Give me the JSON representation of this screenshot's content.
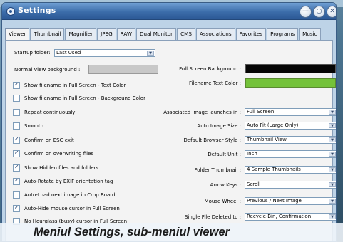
{
  "window": {
    "title": "Settings"
  },
  "tabs": [
    "Viewer",
    "Thumbnail",
    "Magnifier",
    "JPEG",
    "RAW",
    "Dual Monitor",
    "CMS",
    "Associations",
    "Favorites",
    "Programs",
    "Music"
  ],
  "left": {
    "startup_label": "Startup folder:",
    "startup_value": "Last Used",
    "normal_bg_label": "Normal View background :",
    "checkboxes": [
      {
        "label": "Show filename in Full Screen - Text Color",
        "checked": true
      },
      {
        "label": "Show filename in Full Screen - Background Color",
        "checked": false
      },
      {
        "label": "Repeat continuously",
        "checked": false
      },
      {
        "label": "Smooth",
        "checked": false
      },
      {
        "label": "Confirm on ESC exit",
        "checked": true
      },
      {
        "label": "Confirm on overwriting files",
        "checked": true
      },
      {
        "label": "Show Hidden files and folders",
        "checked": true
      },
      {
        "label": "Auto-Rotate by EXIF orientation tag",
        "checked": true
      },
      {
        "label": "Auto-Load next image in Crop Board",
        "checked": false
      },
      {
        "label": "Auto-Hide mouse cursor in Full Screen",
        "checked": true
      },
      {
        "label": "No Hourglass (busy) cursor in Full Screen",
        "checked": false
      }
    ]
  },
  "right": {
    "full_bg_label": "Full Screen Background :",
    "filename_color_label": "Filename Text Color :",
    "rows": [
      {
        "label": "Associated image launches in :",
        "value": "Full Screen"
      },
      {
        "label": "Auto Image Size :",
        "value": "Auto Fit (Large Only)"
      },
      {
        "label": "Default Browser Style :",
        "value": "Thumbnail View"
      },
      {
        "label": "Default Unit :",
        "value": "Inch"
      },
      {
        "label": "Folder Thumbnail :",
        "value": "4 Sample Thumbnails"
      },
      {
        "label": "Arrow Keys :",
        "value": "Scroll"
      },
      {
        "label": "Mouse Wheel :",
        "value": "Previous / Next Image"
      },
      {
        "label": "Single File Deleted to :",
        "value": "Recycle-Bin, Confirmation"
      }
    ]
  },
  "colors": {
    "full_screen_bg": "#050505",
    "filename_text": "#74c23a",
    "normal_bg": "#c8c8c8"
  },
  "caption": "Meniul Settings, sub-meniul viewer"
}
